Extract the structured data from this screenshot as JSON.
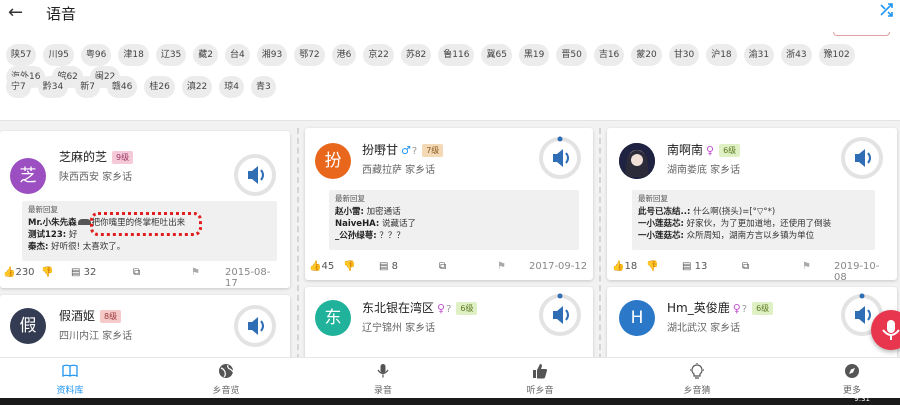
{
  "topbar": {
    "title": "语音"
  },
  "tags": {
    "row1": [
      "陕57",
      "川95",
      "粤96",
      "津18",
      "辽35",
      "藏2",
      "台4",
      "湘93",
      "鄂72",
      "港6",
      "京22",
      "苏82",
      "鲁116",
      "冀65",
      "黑19",
      "晋50",
      "吉16",
      "蒙20",
      "甘30",
      "沪18",
      "渝31",
      "浙43",
      "豫102",
      "海外16",
      "皖62",
      "闽22"
    ],
    "row2": [
      "宁7",
      "黔34",
      "新7",
      "赣46",
      "桂26",
      "滇22",
      "琼4",
      "青3"
    ]
  },
  "cards": [
    {
      "avatar_char": "芝",
      "avatar_color": "#9c4fc0",
      "name": "芝麻的芝",
      "gender": "",
      "level": "9级",
      "level_color": "#f6c9d9",
      "location": "陕西西安 家乡话",
      "reply_title": "最新回复",
      "replies": [
        {
          "user": "Mr.小朱先森",
          "text": "把你嘴里的佟掌柜吐出来"
        },
        {
          "user": "测试123:",
          "text": "好"
        },
        {
          "user": "秦杰:",
          "text": "好听很!  太喜欢了。"
        }
      ],
      "likes": "230",
      "comments": "32",
      "date": "2015-08-17"
    },
    {
      "avatar_char": "扮",
      "avatar_color": "#e8671c",
      "name": "扮嘢甘",
      "gender": "male",
      "gender_symbol": "♂",
      "qmark": "?",
      "level": "7级",
      "level_color": "#f3d9b5",
      "location": "西藏拉萨 家乡话",
      "reply_title": "最新回复",
      "replies": [
        {
          "user": "赵小雷:",
          "text": "加密通话"
        },
        {
          "user": "NaiveHA:",
          "text": "说藏话了"
        },
        {
          "user": "_公孙绿萼:",
          "text": "？？？"
        }
      ],
      "likes": "45",
      "comments": "8",
      "date": "2017-09-12"
    },
    {
      "avatar_char": "",
      "avatar_color": "#1f2240",
      "name": "南啊南",
      "gender": "female",
      "gender_symbol": "♀",
      "level": "6级",
      "level_color": "#dff0c5",
      "location": "湖南娄底 家乡话",
      "reply_title": "最新回复",
      "replies": [
        {
          "user": "此号已冻结..:",
          "text": "什么啊(挠头)=[°▽°*)"
        },
        {
          "user": "一小莲菇芯:",
          "text": "好家伙，为了更加道地，还使用了倒装"
        },
        {
          "user": "一小莲菇芯:",
          "text": "众所周知，湖南方言以乡镇为单位"
        }
      ],
      "likes": "18",
      "comments": "13",
      "date": "2019-10-08"
    },
    {
      "avatar_char": "假",
      "avatar_color": "#333c52",
      "name": "假酒妪",
      "gender": "",
      "level": "8级",
      "level_color": "#f6c9c9",
      "location": "四川内江 家乡话"
    },
    {
      "avatar_char": "东",
      "avatar_color": "#20b29a",
      "name": "东北银在湾区",
      "gender": "female",
      "gender_symbol": "♀",
      "qmark": "?",
      "level": "6级",
      "level_color": "#dff0c5",
      "location": "辽宁锦州 家乡话"
    },
    {
      "avatar_char": "H",
      "avatar_color": "#2b78c8",
      "name": "Hm_英俊鹿",
      "gender": "female",
      "gender_symbol": "♀",
      "qmark": "?",
      "level": "6级",
      "level_color": "#dff0c5",
      "location": "湖北武汉 家乡话"
    }
  ],
  "nav": [
    {
      "label": "资料库",
      "icon": "book-icon",
      "active": true
    },
    {
      "label": "乡音览",
      "icon": "globe-icon",
      "active": false
    },
    {
      "label": "录音",
      "icon": "microphone-icon",
      "active": false
    },
    {
      "label": "听乡音",
      "icon": "thumb-up-icon",
      "active": false
    },
    {
      "label": "乡音猜",
      "icon": "lightbulb-icon",
      "active": false
    },
    {
      "label": "更多",
      "icon": "compass-icon",
      "active": false
    }
  ],
  "colors": {
    "accent": "#2196f3",
    "fab": "#e8364f",
    "highlight": "#e02020"
  },
  "system": {
    "clock": "9:31"
  }
}
